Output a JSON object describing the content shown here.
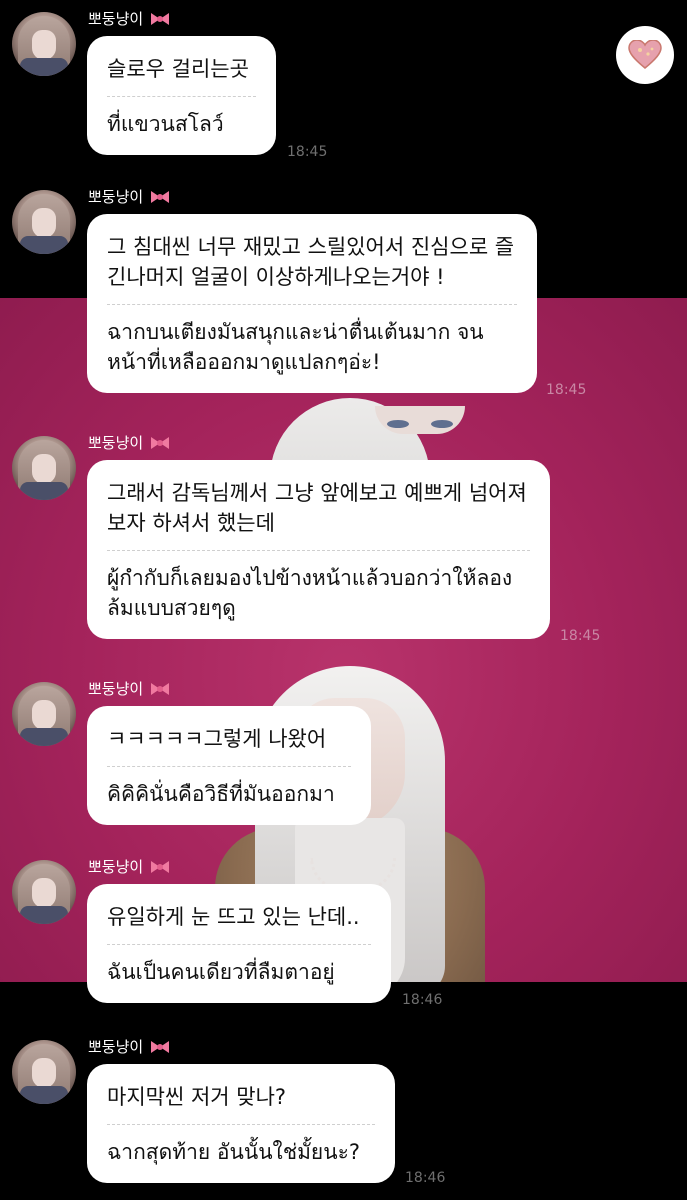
{
  "messages": [
    {
      "sender": "뽀둥냥이",
      "ko": "슬로우 걸리는곳",
      "th": "ที่แขวนสโลว์",
      "time": "18:45"
    },
    {
      "sender": "뽀둥냥이",
      "ko": "그 침대씬 너무 재밌고 스릴있어서 진심으로 즐긴나머지 얼굴이 이상하게나오는거야 !",
      "th": "ฉากบนเตียงมันสนุกและน่าตื่นเต้นมาก จนหน้าที่เหลือออกมาดูแปลกๆอ่ะ!",
      "time": "18:45"
    },
    {
      "sender": "뽀둥냥이",
      "ko": "그래서 감독님께서 그냥 앞에보고 예쁘게 넘어져보자 하셔서 했는데",
      "th": "ผู้กำกับก็เลยมองไปข้างหน้าแล้วบอกว่าให้ลองล้มแบบสวยๆดู",
      "time": "18:45"
    },
    {
      "sender": "뽀둥냥이",
      "ko": "ㅋㅋㅋㅋㅋ그렇게 나왔어",
      "th": "คิคิคินั่นคือวิธีที่มันออกมา",
      "time": ""
    },
    {
      "sender": "뽀둥냥이",
      "ko": "유일하게 눈 뜨고 있는 난데..",
      "th": "ฉันเป็นคนเดียวที่ลืมตาอยู่",
      "time": "18:46"
    },
    {
      "sender": "뽀둥냥이",
      "ko": "마지막씬 저거 맞나?",
      "th": "ฉากสุดท้าย อันนั้นใช่มั้ยนะ?",
      "time": "18:46"
    }
  ],
  "icons": {
    "bow": "pink-ribbon-bow-icon",
    "heart": "heart-reaction-icon",
    "avatar": "profile-avatar"
  },
  "colors": {
    "bubble": "#ffffff",
    "background": "#000000",
    "pink_band": "#a4235b",
    "bow": "#f07aa0",
    "heart": "#e6a1ad"
  }
}
